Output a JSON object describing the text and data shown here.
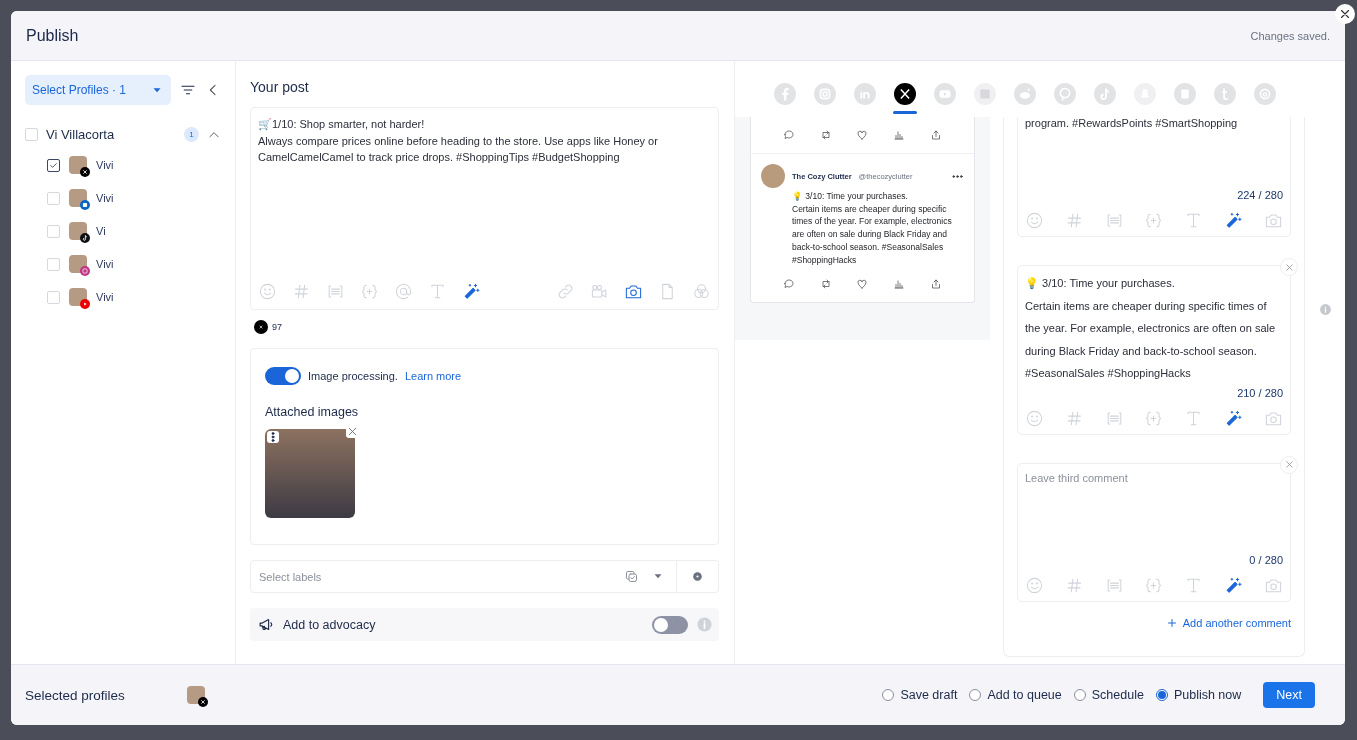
{
  "header": {
    "title": "Publish",
    "status": "Changes saved."
  },
  "profiles": {
    "select_button": "Select Profiles · 1",
    "group": {
      "name": "Vi Villacorta",
      "count": "1",
      "checked": false,
      "expanded": true,
      "accounts": [
        {
          "name": "Vivi",
          "kind": "x",
          "checked": true
        },
        {
          "name": "Vivi",
          "kind": "linkedin",
          "checked": false
        },
        {
          "name": "Vi",
          "kind": "tiktok",
          "checked": false
        },
        {
          "name": "Vivi",
          "kind": "instagram",
          "checked": false
        },
        {
          "name": "Vivi",
          "kind": "youtube",
          "checked": false
        }
      ]
    }
  },
  "post": {
    "heading": "Your post",
    "text": "🛒1/10: Shop smarter, not harder!\nAlways compare prices online before heading to the store. Use apps like Honey or CamelCamelCamel to track price drops. #ShoppingTips #BudgetShopping",
    "char_count": "97",
    "image_processing": {
      "on": true,
      "label": "Image processing.",
      "link": "Learn more"
    },
    "attached_heading": "Attached images",
    "labels_placeholder": "Select labels",
    "advocacy": {
      "label": "Add to advocacy",
      "on": false
    }
  },
  "platforms": [
    {
      "kind": "facebook",
      "selected": false
    },
    {
      "kind": "instagram",
      "selected": false
    },
    {
      "kind": "linkedin",
      "selected": false
    },
    {
      "kind": "x",
      "selected": true
    },
    {
      "kind": "youtube",
      "selected": false
    },
    {
      "kind": "gmb",
      "selected": false
    },
    {
      "kind": "reddit",
      "selected": false
    },
    {
      "kind": "pinterest",
      "selected": false
    },
    {
      "kind": "tiktok",
      "selected": false
    },
    {
      "kind": "snapchat",
      "selected": false
    },
    {
      "kind": "blog",
      "selected": false
    },
    {
      "kind": "tumblr",
      "selected": false
    },
    {
      "kind": "threads",
      "selected": false
    }
  ],
  "preview": {
    "name": "The Cozy Clutter",
    "handle": "@thecozyclutter",
    "text": "💡 3/10: Time your purchases.\nCertain items are cheaper during specific times of the year. For example, electronics are often on sale during Black Friday and back-to-school season. #SeasonalSales #ShoppingHacks"
  },
  "comments": [
    {
      "text": "program. #RewardsPoints #SmartShopping",
      "count": "224 / 280",
      "closable": false
    },
    {
      "text": "💡 3/10: Time your purchases.\nCertain items are cheaper during specific times of the year. For example, electronics are often on sale during Black Friday and back-to-school season. #SeasonalSales #ShoppingHacks",
      "count": "210 / 280",
      "closable": true
    },
    {
      "placeholder": "Leave third comment",
      "count": "0 / 280",
      "closable": true
    }
  ],
  "add_comment": "Add another comment",
  "footer": {
    "label": "Selected profiles",
    "options": [
      {
        "label": "Save draft",
        "selected": false
      },
      {
        "label": "Add to queue",
        "selected": false
      },
      {
        "label": "Schedule",
        "selected": false
      },
      {
        "label": "Publish now",
        "selected": true
      }
    ],
    "next": "Next"
  }
}
